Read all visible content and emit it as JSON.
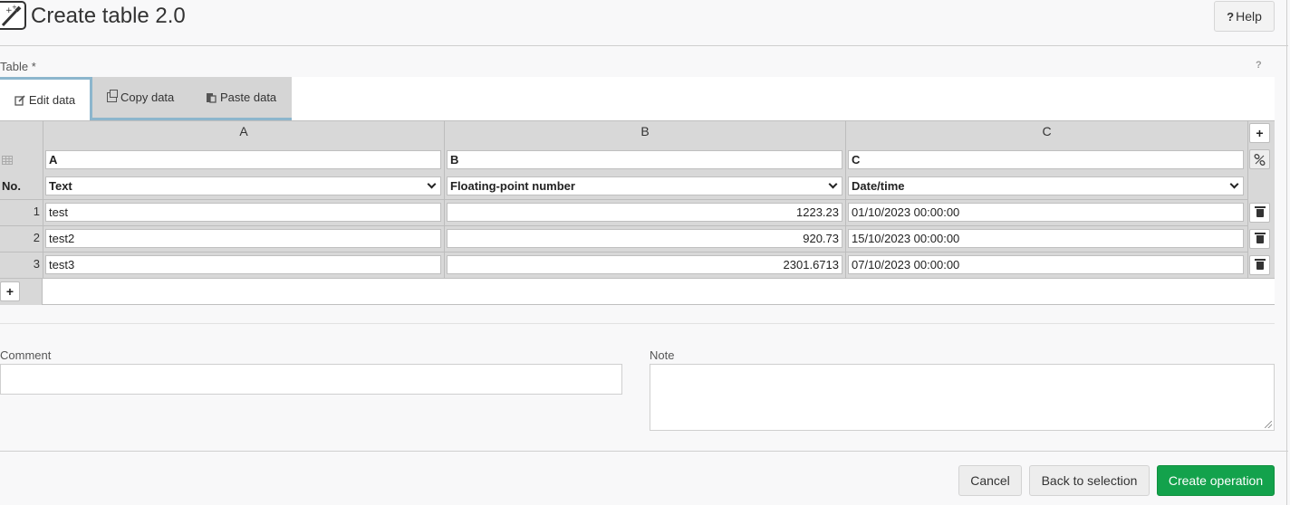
{
  "header": {
    "title": "Create table 2.0",
    "help_label": "Help",
    "help_mark": "?"
  },
  "table_field": {
    "label": "Table *",
    "help_mark": "?"
  },
  "tabs": [
    {
      "label": "Edit data",
      "active": true
    },
    {
      "label": "Copy data",
      "active": false
    },
    {
      "label": "Paste data",
      "active": false
    }
  ],
  "grid": {
    "column_letters": [
      "A",
      "B",
      "C"
    ],
    "column_names": [
      "A",
      "B",
      "C"
    ],
    "no_label": "No.",
    "column_types": [
      "Text",
      "Floating-point number",
      "Date/time"
    ],
    "rows": [
      {
        "no": "1",
        "a": "test",
        "b": "1223.23",
        "c": "01/10/2023 00:00:00"
      },
      {
        "no": "2",
        "a": "test2",
        "b": "920.73",
        "c": "15/10/2023 00:00:00"
      },
      {
        "no": "3",
        "a": "test3",
        "b": "2301.6713",
        "c": "07/10/2023 00:00:00"
      }
    ],
    "add_column_label": "+",
    "add_row_label": "+"
  },
  "comment": {
    "label": "Comment",
    "value": ""
  },
  "note": {
    "label": "Note",
    "value": ""
  },
  "footer": {
    "cancel": "Cancel",
    "back": "Back to selection",
    "create": "Create operation"
  },
  "colors": {
    "primary": "#13a24c",
    "tab_accent": "#8cb6cd"
  }
}
